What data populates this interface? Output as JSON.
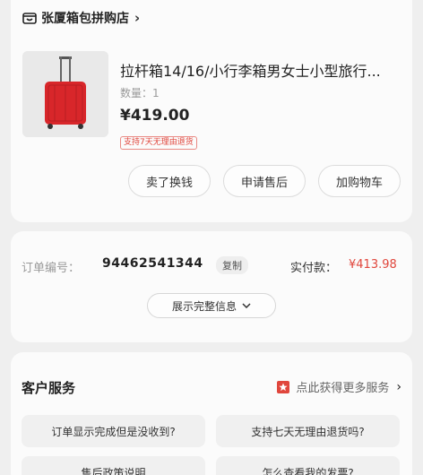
{
  "store": {
    "name": "张厦箱包拼购店",
    "chevron": "›"
  },
  "product": {
    "title": "拉杆箱14/16/小行李箱男女士小型旅行...",
    "quantity": "数量：1",
    "price": "¥419.00",
    "return_tag": "支持7天无理由退货",
    "image_color": "#d8262a"
  },
  "actions": {
    "sell": "卖了换钱",
    "after_sales": "申请售后",
    "add_cart": "加购物车"
  },
  "order": {
    "number_label": "订单编号：",
    "number": "94462541344",
    "copy": "复制",
    "paid_label": "实付款：",
    "paid_value": "¥413.98",
    "expand": "展示完整信息"
  },
  "service": {
    "title": "客户服务",
    "more_link": "点此获得更多服务",
    "faqs": [
      "订单显示完成但是没收到?",
      "支持七天无理由退货吗?",
      "售后政策说明",
      "怎么查看我的发票?"
    ]
  },
  "colors": {
    "accent_red": "#e0463c",
    "background": "#efefef",
    "card": "#fbfbfb"
  }
}
